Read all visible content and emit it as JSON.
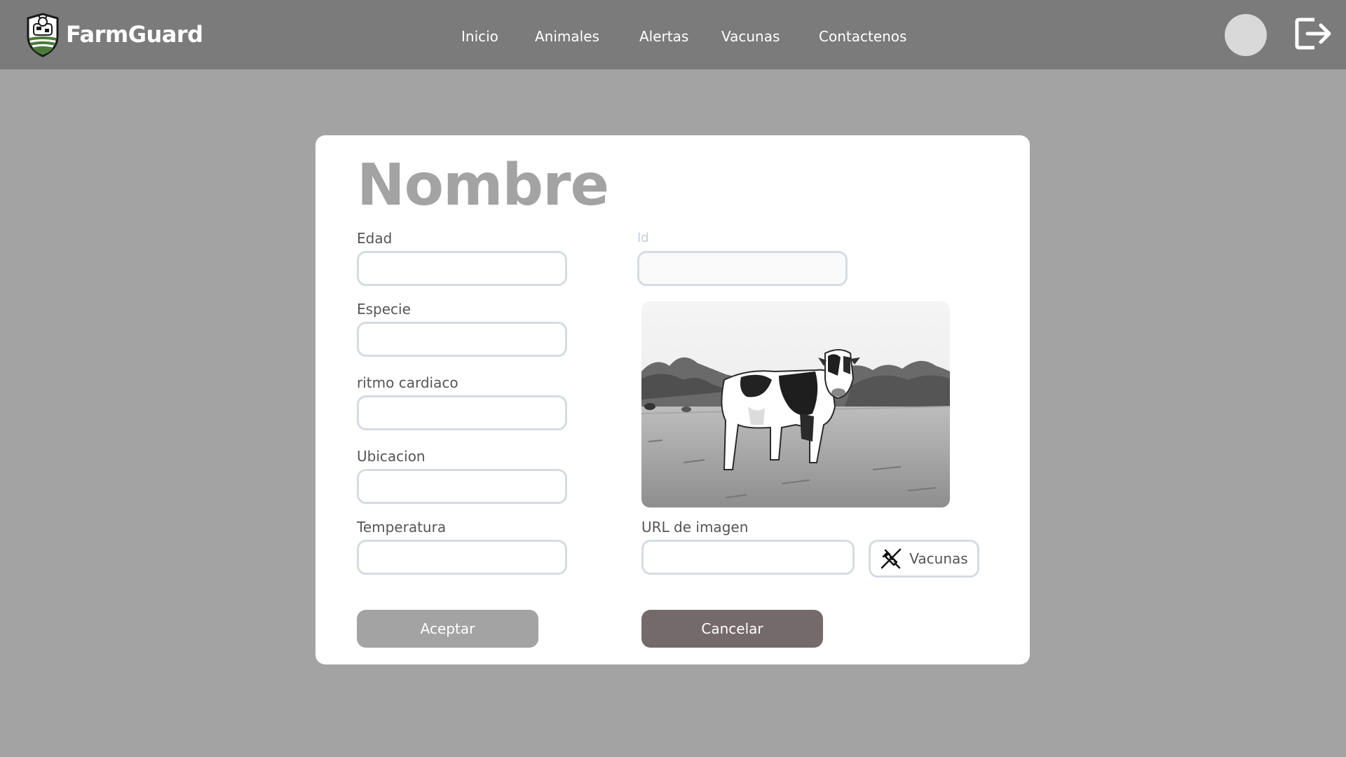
{
  "app": {
    "name": "FarmGuard"
  },
  "nav": {
    "items": [
      "Inicio",
      "Animales",
      "Alertas",
      "Vacunas",
      "Contactenos"
    ]
  },
  "form": {
    "title": "Nombre",
    "fields": {
      "edad": {
        "label": "Edad",
        "value": ""
      },
      "id": {
        "label": "Id",
        "value": ""
      },
      "especie": {
        "label": "Especie",
        "value": ""
      },
      "ritmo": {
        "label": "ritmo cardiaco",
        "value": ""
      },
      "ubicacion": {
        "label": "Ubicacion",
        "value": ""
      },
      "temperatura": {
        "label": "Temperatura",
        "value": ""
      },
      "url": {
        "label": "URL de imagen",
        "value": ""
      }
    },
    "vacunas_button": "Vacunas",
    "accept_button": "Aceptar",
    "cancel_button": "Cancelar"
  },
  "colors": {
    "navbar": "#7b7b7b",
    "background": "#a3a3a3",
    "card": "#ffffff",
    "accept": "#a3a3a3",
    "cancel": "#756a6b",
    "input_border": "#d6dbe2"
  },
  "icons": [
    "farm-shield-logo-icon",
    "avatar",
    "logout-icon",
    "syringe-icon"
  ]
}
